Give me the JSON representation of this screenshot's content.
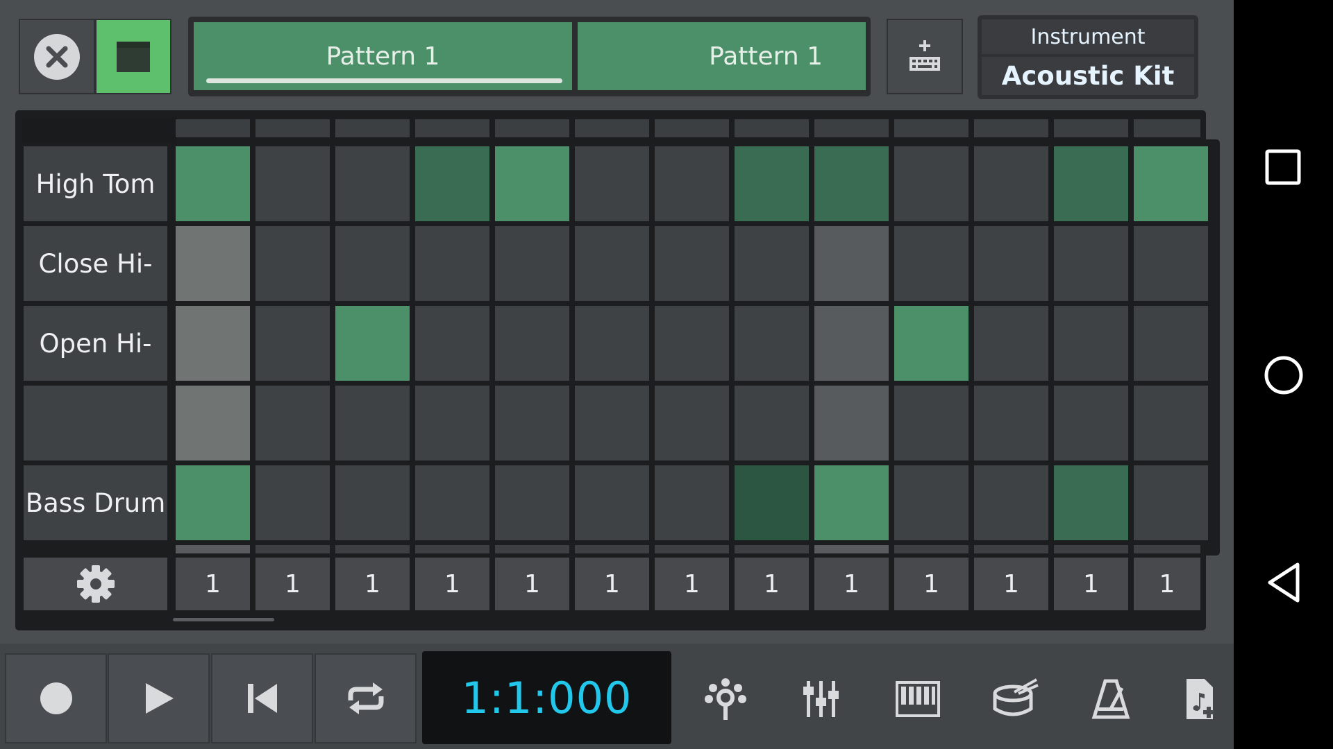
{
  "pattern_tabs": [
    {
      "label": "Pattern 1",
      "selected": true
    },
    {
      "label": "Pattern 1",
      "selected": false
    }
  ],
  "instrument": {
    "caption": "Instrument",
    "name": "Acoustic Kit"
  },
  "rows": [
    {
      "label": "High Tom",
      "cells": [
        "on",
        "off",
        "off",
        "mid",
        "on",
        "off",
        "off",
        "mid",
        "mid",
        "off",
        "off",
        "mid",
        "on"
      ]
    },
    {
      "label": "Close Hi-",
      "cells": [
        "gray",
        "off",
        "off",
        "off",
        "off",
        "off",
        "off",
        "off",
        "gray2",
        "off",
        "off",
        "off",
        "off"
      ]
    },
    {
      "label": "Open Hi-",
      "cells": [
        "gray",
        "off",
        "on",
        "off",
        "off",
        "off",
        "off",
        "off",
        "gray2",
        "on",
        "off",
        "off",
        "off"
      ]
    },
    {
      "label": "",
      "cells": [
        "gray",
        "off",
        "off",
        "off",
        "off",
        "off",
        "off",
        "off",
        "gray2",
        "off",
        "off",
        "off",
        "off"
      ]
    },
    {
      "label": "Bass Drum",
      "cells": [
        "on",
        "off",
        "off",
        "off",
        "off",
        "off",
        "off",
        "dark",
        "on",
        "off",
        "off",
        "mid",
        "off"
      ]
    }
  ],
  "velocities": [
    "1",
    "1",
    "1",
    "1",
    "1",
    "1",
    "1",
    "1",
    "1",
    "1",
    "1",
    "1",
    "1"
  ],
  "transport": {
    "time": "1:1:000"
  },
  "colors": {
    "accent_green": "#4b9068",
    "view_green": "#5ec06c",
    "time_cyan": "#22c8ec"
  },
  "icons": {
    "close": "close-icon",
    "view": "window-icon",
    "add_pattern": "add-keyboard-icon",
    "settings": "gear-icon",
    "record": "record-icon",
    "play": "play-icon",
    "rewind": "skip-back-icon",
    "loop": "loop-icon",
    "effects": "effects-icon",
    "mixer": "mixer-icon",
    "piano": "piano-icon",
    "drum": "drum-icon",
    "metronome": "metronome-icon",
    "add_track": "add-file-icon",
    "nav_recents": "recents-icon",
    "nav_home": "home-icon",
    "nav_back": "back-icon"
  }
}
